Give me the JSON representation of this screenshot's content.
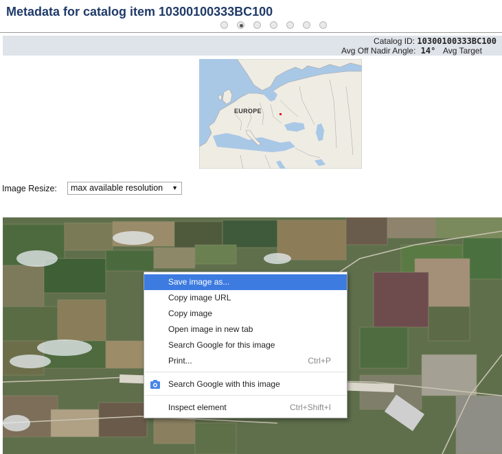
{
  "page": {
    "title": "Metadata for catalog item 10300100333BC100"
  },
  "carousel": {
    "dot_count": 7,
    "active_index": 1
  },
  "info": {
    "catalog_id_label": "Catalog ID:",
    "catalog_id_value": "10300100333BC100",
    "off_nadir_label": "Avg Off Nadir Angle:",
    "off_nadir_value": "14°",
    "avg_target_label": "Avg Target"
  },
  "map": {
    "region_label": "EUROPE",
    "colors": {
      "water": "#a9c8e6",
      "land": "#efece4",
      "border": "#a3a3a3",
      "marker": "#dd1111"
    }
  },
  "image_resize": {
    "label": "Image Resize:",
    "selected": "max available resolution",
    "arrow": "▼"
  },
  "context_menu": {
    "items": [
      {
        "label": "Save image as...",
        "shortcut": "",
        "highlighted": true
      },
      {
        "label": "Copy image URL",
        "shortcut": ""
      },
      {
        "label": "Copy image",
        "shortcut": ""
      },
      {
        "label": "Open image in new tab",
        "shortcut": ""
      },
      {
        "label": "Search Google for this image",
        "shortcut": ""
      },
      {
        "label": "Print...",
        "shortcut": "Ctrl+P"
      }
    ],
    "search_with_image": {
      "label": "Search Google with this image",
      "icon": "camera-icon"
    },
    "inspect": {
      "label": "Inspect element",
      "shortcut": "Ctrl+Shift+I"
    },
    "highlight_color": "#3d7be0"
  },
  "colors": {
    "title": "#1f3a68",
    "infobar_bg": "#dfe3ea"
  }
}
